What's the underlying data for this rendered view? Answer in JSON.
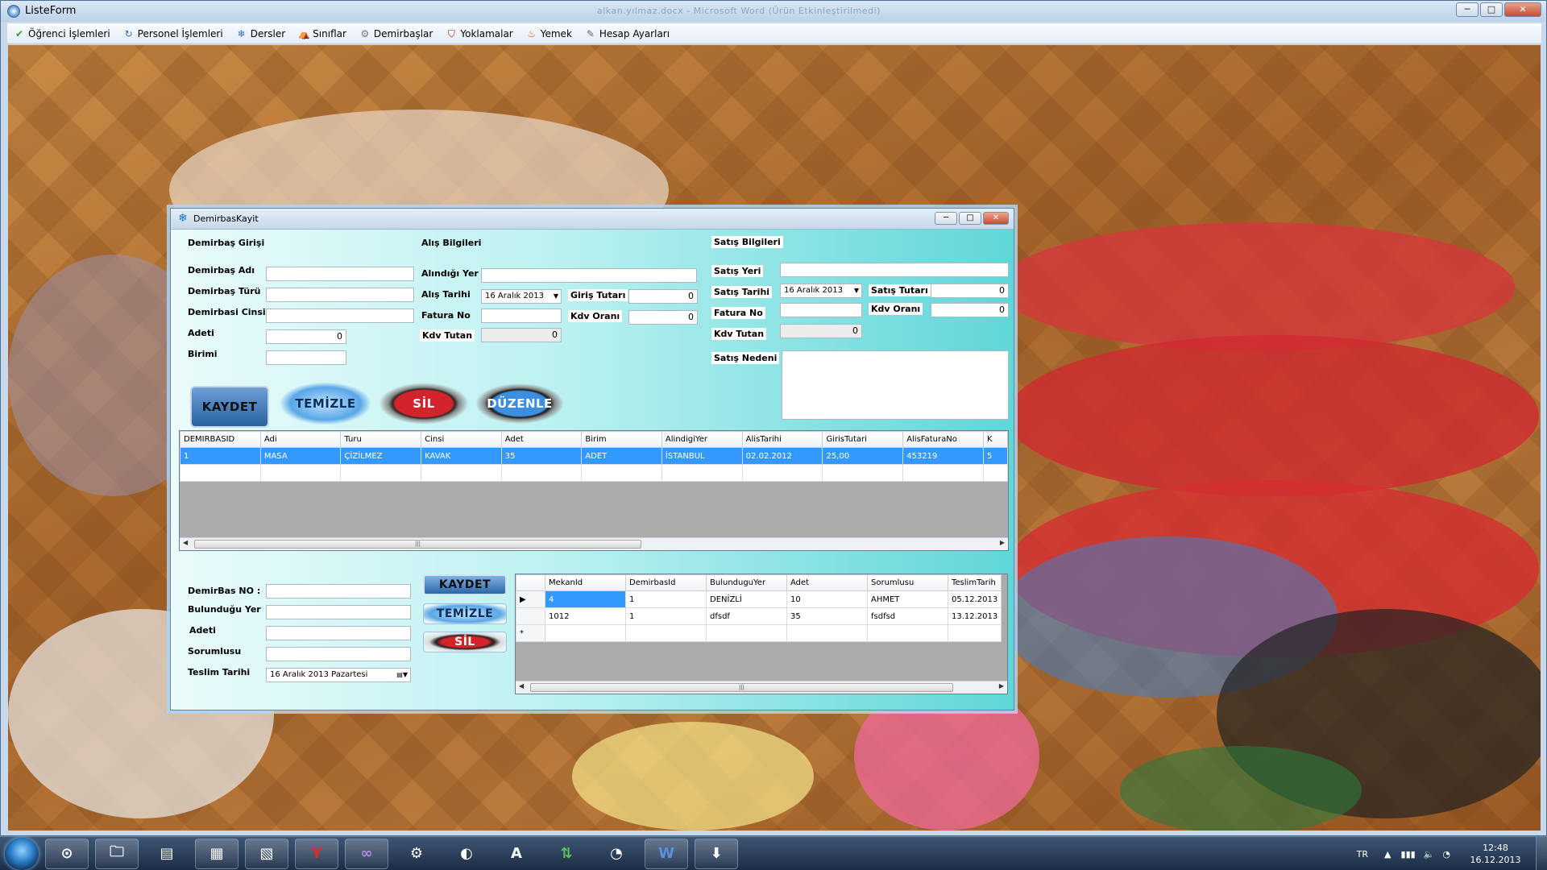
{
  "main_window": {
    "title": "ListeForm",
    "faint_title": "alkan.yılmaz.docx - Microsoft Word (Ürün Etkinleştirilmedi)",
    "buttons": [
      "─",
      "□",
      "✕"
    ]
  },
  "menu": [
    {
      "label": "Öğrenci İşlemleri",
      "icon": "check-icon",
      "color": "#2e9e2e"
    },
    {
      "label": "Personel İşlemleri",
      "icon": "arrows-icon",
      "color": "#2d6fbf"
    },
    {
      "label": "Dersler",
      "icon": "snowflake-icon",
      "color": "#2d6fbf"
    },
    {
      "label": "Sınıflar",
      "icon": "tent-icon",
      "color": "#3b7fc6"
    },
    {
      "label": "Demirbaşlar",
      "icon": "gear-icon",
      "color": "#777777"
    },
    {
      "label": "Yoklamalar",
      "icon": "shield-icon",
      "color": "#8a1f1f"
    },
    {
      "label": "Yemek",
      "icon": "food-icon",
      "color": "#c26b1a"
    },
    {
      "label": "Hesap Ayarları",
      "icon": "settings-icon",
      "color": "#666666"
    }
  ],
  "child": {
    "title": "DemirbasKayit",
    "sections": {
      "giris": "Demirbaş Girişi",
      "alis": "Alış Bilgileri",
      "satis": "Satış Bilgileri"
    },
    "giris": {
      "ad_label": "Demirbaş Adı",
      "ad": "",
      "tur_label": "Demirbaş Türü",
      "tur": "",
      "cins_label": "Demirbasi Cinsi",
      "cins": "",
      "adet_label": "Adeti",
      "adet": "0",
      "birim_label": "Birimi",
      "birim": ""
    },
    "alis": {
      "yer_label": "Alındığı Yer",
      "yer": "",
      "tarih_label": "Alış Tarihi",
      "tarih": "16   Aralık   2013",
      "fatura_label": "Fatura No",
      "fatura": "",
      "kdv_tutan_label": "Kdv Tutan",
      "kdv_tutan": "0",
      "giris_tutan_label": "Giriş Tutarı",
      "giris_tutan": "0",
      "kdv_orani_label": "Kdv Oranı",
      "kdv_orani": "0"
    },
    "satis": {
      "yer_label": "Satış Yeri",
      "yer": "",
      "tarih_label": "Satış Tarihi",
      "tarih": "16   Aralık   2013",
      "fatura_label": "Fatura No",
      "fatura": "",
      "kdv_tutan_label": "Kdv Tutan",
      "kdv_tutan": "0",
      "tutan_label": "Satış Tutarı",
      "tutan": "0",
      "kdv_orani_label": "Kdv Oranı",
      "kdv_orani": "0",
      "neden_label": "Satış Nedeni",
      "neden": ""
    },
    "buttons": {
      "kaydet": "KAYDET",
      "temizle": "TEMİZLE",
      "sil": "SİL",
      "duzenle": "DÜZENLE"
    },
    "grid1": {
      "columns": [
        "DEMIRBASID",
        "Adi",
        "Turu",
        "Cinsi",
        "Adet",
        "Birim",
        "AlindigiYer",
        "AlisTarihi",
        "GirisTutari",
        "AlisFaturaNo",
        "K"
      ],
      "rows": [
        [
          "1",
          "MASA",
          "ÇİZİLMEZ",
          "KAVAK",
          "35",
          "ADET",
          "İSTANBUL",
          "02.02.2012",
          "25,00",
          "453219",
          "5"
        ],
        [
          "",
          "",
          "",
          "",
          "",
          "",
          "",
          "",
          "",
          "",
          ""
        ]
      ]
    },
    "mekan": {
      "no_label": "DemirBas NO :",
      "no": "",
      "yer_label": "Bulunduğu Yer",
      "yer": "",
      "adet_label": "Adeti",
      "adet": "",
      "sorumlu_label": "Sorumlusu",
      "sorumlu": "",
      "teslim_label": "Teslim Tarihi",
      "teslim": "16   Aralık   2013  Pazartesi",
      "buttons": {
        "kaydet": "KAYDET",
        "temizle": "TEMİZLE",
        "sil": "SİL"
      }
    },
    "grid2": {
      "columns": [
        "",
        "MekanId",
        "DemirbasId",
        "BulunduguYer",
        "Adet",
        "Sorumlusu",
        "TeslimTarih"
      ],
      "rows": [
        [
          "▶",
          "4",
          "1",
          "DENİZLİ",
          "10",
          "AHMET",
          "05.12.2013"
        ],
        [
          "",
          "1012",
          "1",
          "dfsdf",
          "35",
          "fsdfsd",
          "13.12.2013"
        ],
        [
          "*",
          "",
          "",
          "",
          "",
          "",
          ""
        ]
      ]
    }
  },
  "taskbar": {
    "apps": [
      "⊙",
      "🗀",
      "▤",
      "▦",
      "▧",
      "Y",
      "∞",
      "⚙",
      "◐",
      "A",
      "⇅",
      "◔",
      "W",
      "⬇"
    ],
    "lang": "TR",
    "time": "12:48",
    "date": "16.12.2013"
  }
}
